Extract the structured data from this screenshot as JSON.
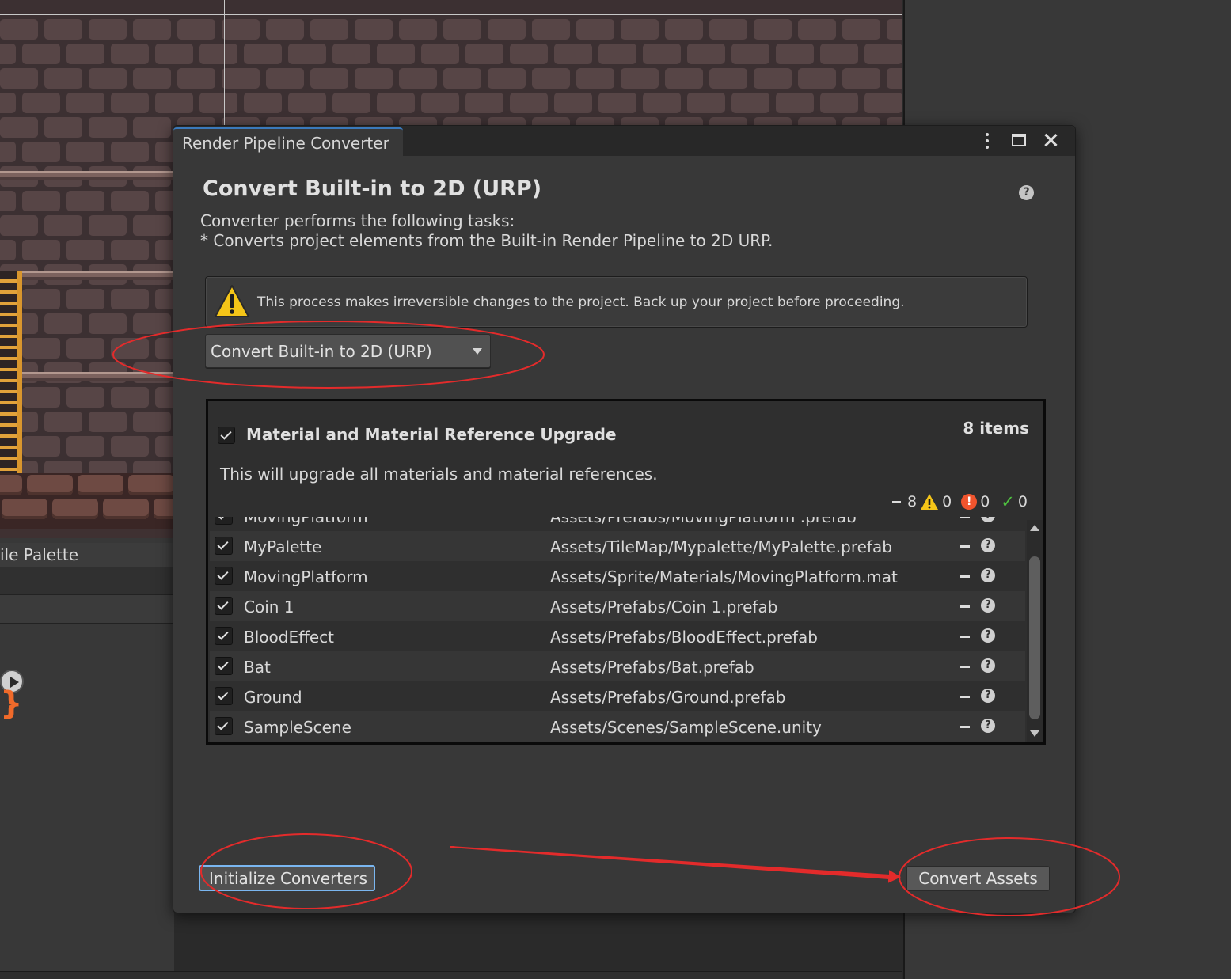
{
  "window": {
    "title": "Render Pipeline Converter"
  },
  "background": {
    "palette_tab_label": "ile Palette"
  },
  "dialog": {
    "heading": "Convert Built-in to 2D (URP)",
    "description_line1": "Converter performs the following tasks:",
    "description_line2": "* Converts project elements from the Built-in Render Pipeline to 2D URP.",
    "warning_text": "This process makes irreversible changes to the project. Back up your project before proceeding.",
    "dropdown_selected": "Convert Built-in to 2D (URP)"
  },
  "converter": {
    "name": "Material and Material Reference Upgrade",
    "count_label": "8 items",
    "description": "This will upgrade all materials and material references.",
    "status": {
      "pending": "8",
      "warnings": "0",
      "errors": "0",
      "success": "0"
    },
    "partial_row": {
      "name": "MovingPlatform",
      "path": "Assets/Prefabs/MovingPlatform .prefab"
    },
    "rows": [
      {
        "name": "MyPalette",
        "path": "Assets/TileMap/Mypalette/MyPalette.prefab",
        "checked": true
      },
      {
        "name": "MovingPlatform",
        "path": "Assets/Sprite/Materials/MovingPlatform.mat",
        "checked": true
      },
      {
        "name": "Coin 1",
        "path": "Assets/Prefabs/Coin 1.prefab",
        "checked": true
      },
      {
        "name": "BloodEffect",
        "path": "Assets/Prefabs/BloodEffect.prefab",
        "checked": true
      },
      {
        "name": "Bat",
        "path": "Assets/Prefabs/Bat.prefab",
        "checked": true
      },
      {
        "name": "Ground",
        "path": "Assets/Prefabs/Ground.prefab",
        "checked": true
      },
      {
        "name": "SampleScene",
        "path": "Assets/Scenes/SampleScene.unity",
        "checked": true
      }
    ]
  },
  "buttons": {
    "initialize": "Initialize Converters",
    "convert": "Convert Assets"
  },
  "colors": {
    "annotation_red": "#e32b2b",
    "focus_blue": "#7ab6f0",
    "warning_yellow": "#f5c518",
    "error_orange": "#f0542d",
    "success_green": "#4fc140"
  },
  "icons": [
    "kebab-menu-icon",
    "maximize-icon",
    "close-icon",
    "help-icon",
    "warning-icon",
    "dropdown-caret-icon",
    "checkbox-icon",
    "error-icon",
    "success-check-icon",
    "scroll-up-icon",
    "scroll-down-icon",
    "play-icon"
  ]
}
